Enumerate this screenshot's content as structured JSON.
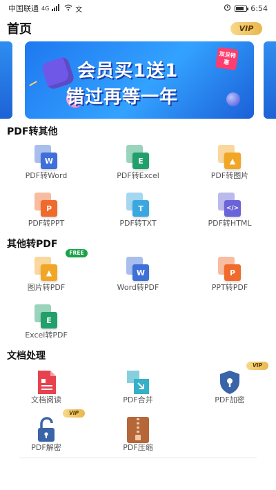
{
  "status_bar": {
    "carrier": "中国联通",
    "network": "4G",
    "time": "6:54",
    "battery_level": 0.8
  },
  "header": {
    "title": "首页",
    "vip_label": "VIP"
  },
  "banner": {
    "line1": "会员买1送1",
    "line2": "错过再等一年",
    "tag": "双旦特惠"
  },
  "sections": [
    {
      "title": "PDF转其他",
      "tools": [
        {
          "label": "PDF转Word",
          "icon": "word-icon",
          "glyph": "W",
          "color": "#3f6fd8"
        },
        {
          "label": "PDF转Excel",
          "icon": "excel-icon",
          "glyph": "E",
          "color": "#22a06b"
        },
        {
          "label": "PDF转图片",
          "icon": "image-icon",
          "glyph": "▲",
          "color": "#f2a626"
        },
        {
          "label": "PDF转PPT",
          "icon": "ppt-icon",
          "glyph": "P",
          "color": "#f06a2c"
        },
        {
          "label": "PDF转TXT",
          "icon": "txt-icon",
          "glyph": "T",
          "color": "#3aa7e0"
        },
        {
          "label": "PDF转HTML",
          "icon": "html-icon",
          "glyph": "</>",
          "color": "#6b63d8"
        }
      ]
    },
    {
      "title": "其他转PDF",
      "free_label": "FREE",
      "tools": [
        {
          "label": "图片转PDF",
          "icon": "image-to-pdf-icon",
          "glyph": "▲",
          "color": "#f2a626"
        },
        {
          "label": "Word转PDF",
          "icon": "word-to-pdf-icon",
          "glyph": "W",
          "color": "#3f6fd8"
        },
        {
          "label": "PPT转PDF",
          "icon": "ppt-to-pdf-icon",
          "glyph": "P",
          "color": "#f06a2c"
        },
        {
          "label": "Excel转PDF",
          "icon": "excel-to-pdf-icon",
          "glyph": "E",
          "color": "#22a06b"
        }
      ]
    },
    {
      "title": "文档处理",
      "vip_label": "VIP",
      "tools": [
        {
          "label": "文档阅读",
          "icon": "document-read-icon",
          "color": "#e8424f"
        },
        {
          "label": "PDF合并",
          "icon": "merge-icon",
          "color": "#35b0c6"
        },
        {
          "label": "PDF加密",
          "icon": "lock-shield-icon",
          "color": "#3a64a8"
        },
        {
          "label": "PDF解密",
          "icon": "unlock-icon",
          "color": "#3a64a8"
        },
        {
          "label": "PDF压缩",
          "icon": "zip-icon",
          "color": "#b5673a"
        }
      ]
    }
  ]
}
